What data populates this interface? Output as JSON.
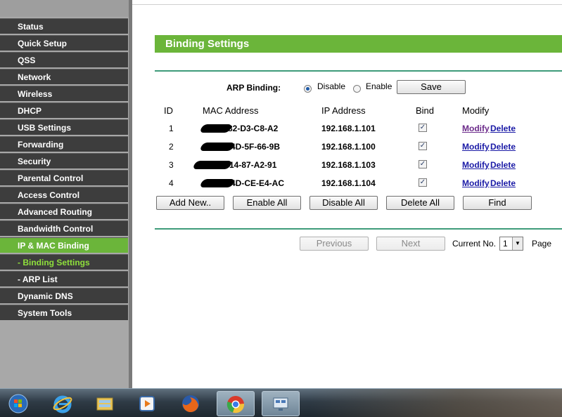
{
  "sidebar": {
    "items": [
      {
        "label": "Status"
      },
      {
        "label": "Quick Setup"
      },
      {
        "label": "QSS"
      },
      {
        "label": "Network"
      },
      {
        "label": "Wireless"
      },
      {
        "label": "DHCP"
      },
      {
        "label": "USB Settings"
      },
      {
        "label": "Forwarding"
      },
      {
        "label": "Security"
      },
      {
        "label": "Parental Control"
      },
      {
        "label": "Access Control"
      },
      {
        "label": "Advanced Routing"
      },
      {
        "label": "Bandwidth Control"
      },
      {
        "label": "IP & MAC Binding"
      },
      {
        "label": "- Binding Settings"
      },
      {
        "label": "- ARP List"
      },
      {
        "label": "Dynamic DNS"
      },
      {
        "label": "System Tools"
      }
    ]
  },
  "page": {
    "title": "Binding Settings",
    "arp_binding_label": "ARP Binding:",
    "disable_label": "Disable",
    "enable_label": "Enable",
    "save_label": "Save",
    "arp_binding_value": "Disable"
  },
  "table": {
    "headers": [
      "ID",
      "MAC Address",
      "IP Address",
      "Bind",
      "Modify"
    ],
    "rows": [
      {
        "id": "1",
        "mac_visible": "82-D3-C8-A2",
        "ip": "192.168.1.101",
        "bind": true,
        "modify": "Modify",
        "delete": "Delete"
      },
      {
        "id": "2",
        "mac_visible": "4D-5F-66-9B",
        "ip": "192.168.1.100",
        "bind": true,
        "modify": "Modify",
        "delete": "Delete"
      },
      {
        "id": "3",
        "mac_visible": "14-87-A2-91",
        "ip": "192.168.1.103",
        "bind": true,
        "modify": "Modify",
        "delete": "Delete"
      },
      {
        "id": "4",
        "mac_visible": "4D-CE-E4-AC",
        "ip": "192.168.1.104",
        "bind": true,
        "modify": "Modify",
        "delete": "Delete"
      }
    ]
  },
  "actions": {
    "add_new": "Add New..",
    "enable_all": "Enable All",
    "disable_all": "Disable All",
    "delete_all": "Delete All",
    "find": "Find"
  },
  "pager": {
    "previous": "Previous",
    "next": "Next",
    "current_no_label": "Current No.",
    "current_no_value": "1",
    "page_label": "Page"
  },
  "taskbar": {
    "icons": [
      "start-orb-icon",
      "internet-explorer-icon",
      "file-explorer-icon",
      "media-player-icon",
      "firefox-icon",
      "chrome-icon",
      "remote-desktop-icon"
    ]
  },
  "colors": {
    "accent_green": "#6bb53a",
    "sidebar_dark": "#3d3d3d",
    "sub_active_text": "#8fe03c",
    "divider_teal": "#3e9b7a",
    "link_blue": "#1a1aa6"
  }
}
